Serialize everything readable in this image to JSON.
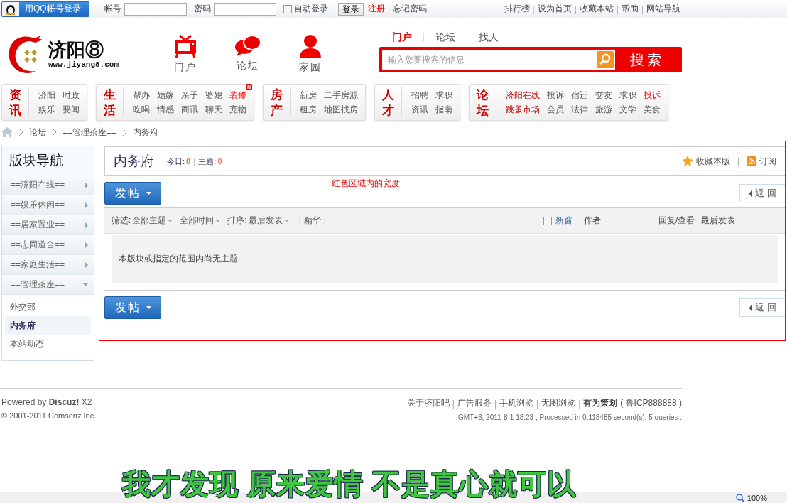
{
  "topbar": {
    "qq_login": "用QQ帐号登录",
    "account_label": "帐号",
    "password_label": "密码",
    "auto_login": {
      "label": "自动登录",
      "checked": false
    },
    "login_button": "登录",
    "links": [
      {
        "label": "注册",
        "kind": "highlight"
      },
      {
        "label": "|",
        "kind": "separator"
      },
      {
        "label": "忘记密码",
        "kind": "normal"
      }
    ],
    "right_links": [
      {
        "label": "排行榜",
        "kind": "normal"
      },
      {
        "label": "|",
        "kind": "separator"
      },
      {
        "label": "设为首页",
        "kind": "normal"
      },
      {
        "label": "|",
        "kind": "separator"
      },
      {
        "label": "收藏本站",
        "kind": "normal"
      },
      {
        "label": "|",
        "kind": "separator"
      },
      {
        "label": "帮助",
        "kind": "normal"
      },
      {
        "label": "|",
        "kind": "separator"
      },
      {
        "label": "网站导航",
        "kind": "normal"
      }
    ]
  },
  "header": {
    "logo": {
      "name": "济阳⑧",
      "url": "www.jiyang8.com"
    },
    "nav": [
      {
        "label": "门户",
        "kind": "tv"
      },
      {
        "label": "论坛",
        "kind": "chat"
      },
      {
        "label": "家园",
        "kind": "person"
      }
    ],
    "search": {
      "tabs": [
        {
          "label": "门户",
          "selected": true
        },
        {
          "label": "论坛",
          "selected": false
        },
        {
          "label": "找人",
          "selected": false
        }
      ],
      "placeholder": "输入您要搜索的信息",
      "button": "搜索"
    }
  },
  "categories": [
    {
      "title": "资讯",
      "links": [
        {
          "label": "济阳",
          "kind": "normal"
        },
        {
          "label": "时政",
          "kind": "normal"
        },
        {
          "label": "娱乐",
          "kind": "normal"
        },
        {
          "label": "要闻",
          "kind": "normal"
        }
      ]
    },
    {
      "title": "生活",
      "links": [
        {
          "label": "帮办",
          "kind": "normal"
        },
        {
          "label": "婚嫁",
          "kind": "normal"
        },
        {
          "label": "亲子",
          "kind": "normal"
        },
        {
          "label": "婆媳",
          "kind": "normal"
        },
        {
          "label": "装修",
          "kind": "hot",
          "badge": "N"
        },
        {
          "label": "吃喝",
          "kind": "normal"
        },
        {
          "label": "情感",
          "kind": "normal"
        },
        {
          "label": "商讯",
          "kind": "normal"
        },
        {
          "label": "聊天",
          "kind": "normal"
        },
        {
          "label": "宠物",
          "kind": "normal"
        }
      ]
    },
    {
      "title": "房产",
      "links": [
        {
          "label": "新房",
          "kind": "normal"
        },
        {
          "label": "二手房源",
          "kind": "normal"
        },
        {
          "label": "租房",
          "kind": "normal"
        },
        {
          "label": "地图找房",
          "kind": "normal"
        }
      ]
    },
    {
      "title": "人才",
      "links": [
        {
          "label": "招聘",
          "kind": "normal"
        },
        {
          "label": "求职",
          "kind": "normal"
        },
        {
          "label": "资讯",
          "kind": "normal"
        },
        {
          "label": "指南",
          "kind": "normal"
        }
      ]
    },
    {
      "title": "论坛",
      "links": [
        {
          "label": "济阳在线",
          "kind": "featured"
        },
        {
          "label": "投诉",
          "kind": "normal"
        },
        {
          "label": "宿迁",
          "kind": "normal"
        },
        {
          "label": "交友",
          "kind": "normal"
        },
        {
          "label": "求职",
          "kind": "normal"
        },
        {
          "label": "投诉",
          "kind": "hot"
        },
        {
          "label": "跳蚤市场",
          "kind": "featured"
        },
        {
          "label": "会员",
          "kind": "normal"
        },
        {
          "label": "法律",
          "kind": "normal"
        },
        {
          "label": "旅游",
          "kind": "normal"
        },
        {
          "label": "文学",
          "kind": "normal"
        },
        {
          "label": "美食",
          "kind": "normal"
        }
      ]
    }
  ],
  "breadcrumb": [
    "论坛",
    "==管理茶座==",
    "内务府"
  ],
  "sidebar": {
    "title": "版块导航",
    "sections": [
      {
        "label": "==济阳在线==",
        "expanded": false
      },
      {
        "label": "==娱乐休闲==",
        "expanded": false
      },
      {
        "label": "==居家置业==",
        "expanded": false
      },
      {
        "label": "==志同道合==",
        "expanded": false
      },
      {
        "label": "==家庭生活==",
        "expanded": false
      },
      {
        "label": "==管理茶座==",
        "expanded": true,
        "children": [
          {
            "label": "外交部",
            "selected": false
          },
          {
            "label": "内务府",
            "selected": true
          },
          {
            "label": "本站动态",
            "selected": false
          }
        ]
      }
    ]
  },
  "forum": {
    "title": "内务府",
    "stats": [
      {
        "kind": "stat",
        "label": "今日:",
        "value": "0"
      },
      {
        "kind": "separator",
        "label": "|"
      },
      {
        "kind": "stat",
        "label": "主题:",
        "value": "0"
      }
    ],
    "actions": [
      {
        "label": "收藏本版",
        "kind": "star"
      },
      {
        "label": "|",
        "kind": "separator"
      },
      {
        "label": "订阅",
        "kind": "rss"
      }
    ],
    "note": "红色区域内的宽度",
    "toolbars": [
      {
        "post": "发帖",
        "back": "返 回"
      },
      {
        "post": "发帖",
        "back": "返 回"
      }
    ],
    "filters": [
      {
        "label": "筛选:",
        "value": "全部主题"
      },
      {
        "value": "全部时间"
      },
      {
        "label": "排序:",
        "value": "最后发表"
      }
    ],
    "digest": [
      {
        "label": "|",
        "kind": "separator"
      },
      {
        "label": "精华",
        "kind": "link"
      },
      {
        "label": "|",
        "kind": "separator"
      }
    ],
    "new_window": {
      "label": "新窗",
      "checked": false
    },
    "columns": [
      "作者",
      "回复/查看",
      "最后发表"
    ],
    "empty_message": "本版块或指定的范围内尚无主题"
  },
  "footer": {
    "powered": "Powered by **Discuz!** X2",
    "copyright": "© 2001-2011 Comsenz Inc.",
    "links": [
      {
        "label": "关于济阳吧",
        "kind": "link"
      },
      {
        "label": "|",
        "kind": "separator"
      },
      {
        "label": "广告服务",
        "kind": "link"
      },
      {
        "label": "|",
        "kind": "separator"
      },
      {
        "label": "手机浏览",
        "kind": "link"
      },
      {
        "label": "|",
        "kind": "separator"
      },
      {
        "label": "无图浏览",
        "kind": "link"
      },
      {
        "label": "|",
        "kind": "separator"
      }
    ],
    "credit": "有为策划",
    "icp": "( 鲁ICP888888 )",
    "meta": "GMT+8, 2011-8-1 18:23 , Processed in 0.118485 second(s), 5 queries ."
  },
  "lyric": "我才发现 原来爱情 不是真心就可以",
  "status_bar": {
    "zoom": "100%"
  }
}
